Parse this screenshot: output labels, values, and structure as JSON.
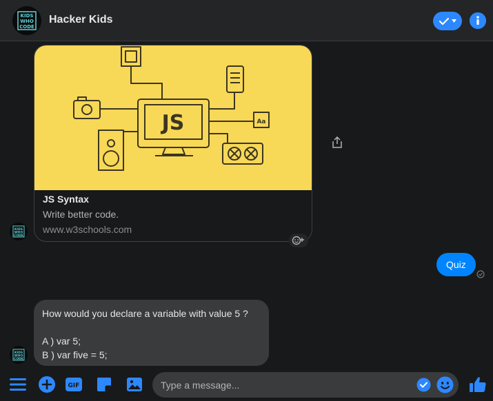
{
  "header": {
    "title": "Hacker Kids",
    "avatar_logo_text": "KIDS WHO CODE",
    "check_icon": "check-icon",
    "info_icon": "info-icon"
  },
  "messages": {
    "link_card": {
      "image_text": "JS",
      "image_icon_label": "Aa",
      "title": "JS Syntax",
      "subtitle": "Write better code.",
      "url": "www.w3schools.com"
    },
    "my_message": "Quiz",
    "bot_message": {
      "lines": [
        "How would you declare a variable with value 5 ?",
        "",
        "A ) var 5;",
        "B ) var five = 5;"
      ]
    }
  },
  "composer": {
    "placeholder": "Type a message...",
    "gif_label": "GIF"
  },
  "colors": {
    "accent": "#2d88ff",
    "my_bubble": "#0084ff",
    "bot_bubble": "#3a3b3c",
    "preview_bg": "#f7d857",
    "background": "#18191a",
    "header": "#242526"
  }
}
